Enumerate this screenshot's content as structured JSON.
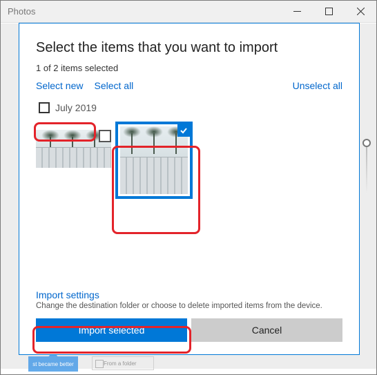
{
  "window": {
    "title": "Photos"
  },
  "dialog": {
    "heading": "Select the items that you want to import",
    "status": "1 of 2 items selected",
    "links": {
      "select_new": "Select new",
      "select_all": "Select all",
      "unselect_all": "Unselect all"
    },
    "group": {
      "label": "July 2019"
    },
    "thumbs": [
      {
        "selected": false
      },
      {
        "selected": true
      }
    ],
    "settings": {
      "link": "Import settings",
      "desc": "Change the destination folder or choose to delete imported items from the device."
    },
    "buttons": {
      "import": "Import selected",
      "cancel": "Cancel"
    }
  },
  "bg": {
    "tile1": "st became better",
    "tile2": "From a folder"
  }
}
